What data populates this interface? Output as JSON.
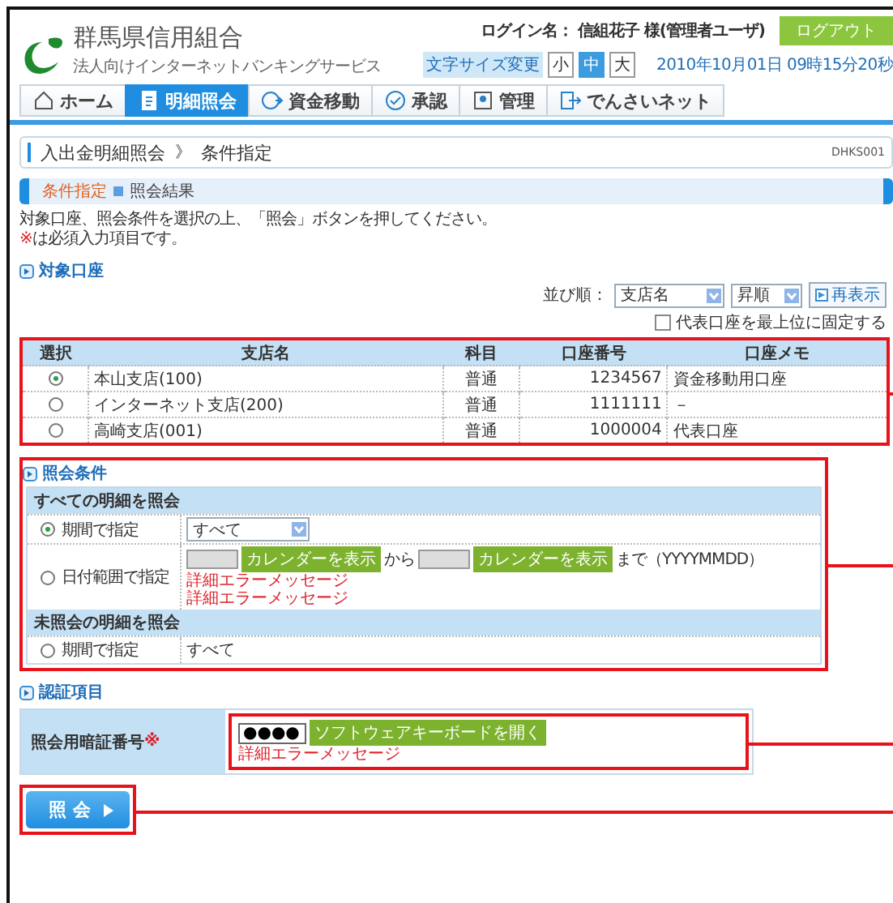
{
  "header": {
    "bank_name": "群馬県信用組合",
    "service_name": "法人向けインターネットバンキングサービス",
    "login_label": "ログイン名：",
    "login_user": "信組花子 様(管理者ユーザ)",
    "logout": "ログアウト",
    "font_size_label": "文字サイズ変更",
    "font_sizes": [
      {
        "label": "小",
        "selected": false
      },
      {
        "label": "中",
        "selected": true
      },
      {
        "label": "大",
        "selected": false
      }
    ],
    "datetime": "2010年10月01日 09時15分20秒"
  },
  "tabs": [
    {
      "label": "ホーム",
      "selected": false
    },
    {
      "label": "明細照会",
      "selected": true
    },
    {
      "label": "資金移動",
      "selected": false
    },
    {
      "label": "承認",
      "selected": false
    },
    {
      "label": "管理",
      "selected": false
    },
    {
      "label": "でんさいネット",
      "selected": false
    }
  ],
  "page": {
    "title": "入出金明細照会",
    "separator": "》",
    "subtitle": "条件指定",
    "screen_id": "DHKS001"
  },
  "steps": [
    {
      "label": "条件指定",
      "selected": true
    },
    {
      "label": "照会結果",
      "selected": false
    }
  ],
  "instructions": "対象口座、照会条件を選択の上、「照会」ボタンを押してください。",
  "required_mark": "※",
  "required_note": "は必須入力項目です。",
  "accounts": {
    "heading": "対象口座",
    "sort_label": "並び順：",
    "sort_key": "支店名",
    "sort_order": "昇順",
    "redisplay": "再表示",
    "pin_representative": {
      "label": "代表口座を最上位に固定する",
      "checked": false
    },
    "columns": [
      "選択",
      "支店名",
      "科目",
      "口座番号",
      "口座メモ"
    ],
    "rows": [
      {
        "selected": true,
        "branch": "本山支店(100)",
        "subject": "普通",
        "number": "1234567",
        "memo": "資金移動用口座"
      },
      {
        "selected": false,
        "branch": "インターネット支店(200)",
        "subject": "普通",
        "number": "1111111",
        "memo": "－"
      },
      {
        "selected": false,
        "branch": "高崎支店(001)",
        "subject": "普通",
        "number": "1000004",
        "memo": "代表口座"
      }
    ]
  },
  "conditions": {
    "heading": "照会条件",
    "groups": [
      {
        "title": "すべての明細を照会",
        "options": [
          {
            "kind": "period",
            "label": "期間で指定",
            "selected": true,
            "value": "すべて"
          },
          {
            "kind": "range",
            "label": "日付範囲で指定",
            "selected": false,
            "calendar_buttons": [
              "カレンダーを表示",
              "カレンダーを表示"
            ],
            "from": "から",
            "until": "まで（YYYYMMDD）",
            "errors": [
              "詳細エラーメッセージ",
              "詳細エラーメッセージ"
            ]
          }
        ]
      },
      {
        "title": "未照会の明細を照会",
        "options": [
          {
            "kind": "fixed",
            "label": "期間で指定",
            "selected": false,
            "value": "すべて"
          }
        ]
      }
    ]
  },
  "auth": {
    "heading": "認証項目",
    "label": "照会用暗証番号",
    "required_mark": "※",
    "value": "●●●●",
    "keyboard_button": "ソフトウェアキーボードを開く",
    "error": "詳細エラーメッセージ"
  },
  "submit": "照 会"
}
